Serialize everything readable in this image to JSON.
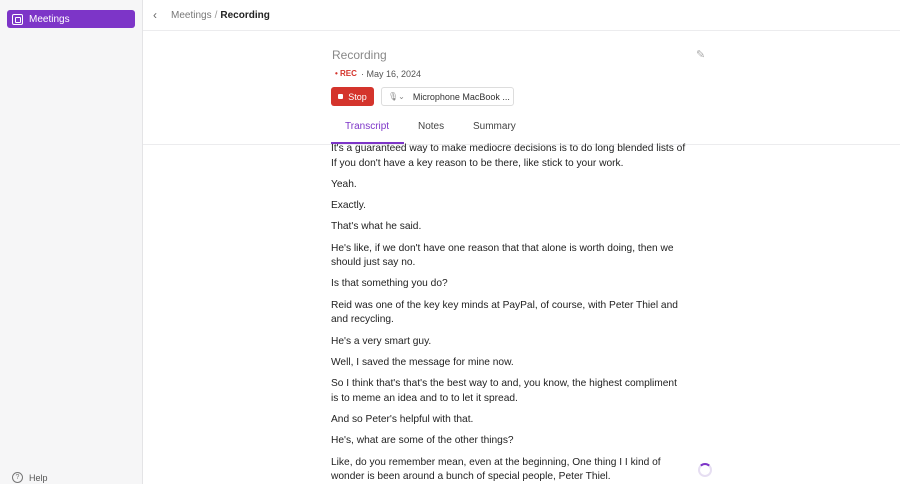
{
  "sidebar": {
    "nav_label": "Meetings",
    "help_label": "Help"
  },
  "topbar": {
    "back_icon": "‹",
    "crumb_parent": "Meetings",
    "crumb_sep": "/",
    "crumb_current": "Recording"
  },
  "header": {
    "title": "Recording",
    "edit_icon": "✎",
    "rec_label": "• REC",
    "date": "· May 16, 2024",
    "stop_label": "Stop",
    "mic_icon": "🎙︎⌄",
    "mic_label": "Microphone MacBook ...",
    "tabs": [
      "Transcript",
      "Notes",
      "Summary"
    ],
    "active_tab": "Transcript"
  },
  "transcript": [
    "It's a guaranteed way to make mediocre decisions is to do long blended lists of If you don't have a key reason to be there, like stick to your work.",
    "Yeah.",
    "Exactly.",
    "That's what he said.",
    "He's like, if we don't have one reason that that alone is worth doing, then we should just say no.",
    "Is that something you do?",
    "Reid was one of the key key minds at PayPal, of course, with Peter Thiel and and recycling.",
    "He's a very smart guy.",
    "Well, I saved the message for mine now.",
    "So I think that's that's the best way to and, you know, the highest compliment is to meme an idea and to to let it spread.",
    "And so Peter's helpful with that.",
    "He's, what are some of the other things?",
    "Like, do you remember mean, even at the beginning, One thing I I kind of wonder is been around a bunch of special people, Peter Thiel."
  ]
}
